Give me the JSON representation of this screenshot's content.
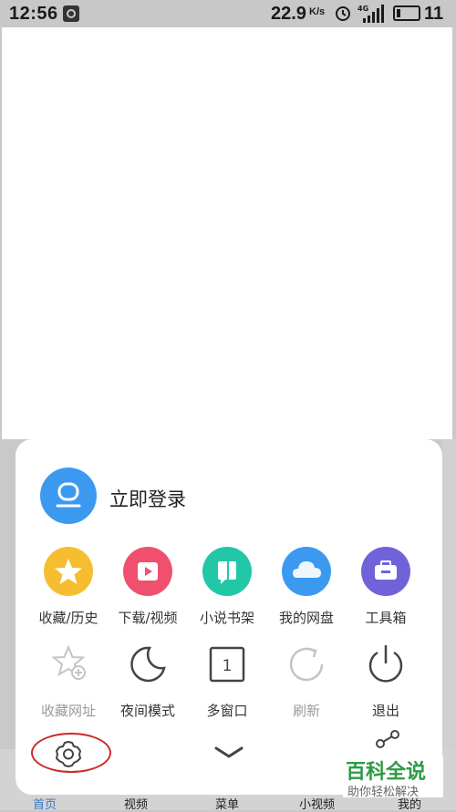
{
  "status_bar": {
    "time": "12:56",
    "speed": "22.9",
    "speed_unit": "K/s",
    "network": "4G",
    "battery": "11"
  },
  "menu": {
    "login_label": "立即登录",
    "row1": [
      {
        "label": "收藏/历史",
        "icon": "star-icon",
        "color": "#f6bd30"
      },
      {
        "label": "下载/视频",
        "icon": "download-video-icon",
        "color": "#f0506e"
      },
      {
        "label": "小说书架",
        "icon": "book-icon",
        "color": "#22c7a8"
      },
      {
        "label": "我的网盘",
        "icon": "cloud-icon",
        "color": "#3b9af0"
      },
      {
        "label": "工具箱",
        "icon": "toolbox-icon",
        "color": "#7063d9"
      }
    ],
    "row2": [
      {
        "label": "收藏网址",
        "icon": "bookmark-add-icon"
      },
      {
        "label": "夜间模式",
        "icon": "moon-icon"
      },
      {
        "label": "多窗口",
        "icon": "window-count-icon",
        "count": "1"
      },
      {
        "label": "刷新",
        "icon": "refresh-icon"
      },
      {
        "label": "退出",
        "icon": "power-icon"
      }
    ]
  },
  "bottom_nav": {
    "items": [
      "首页",
      "视频",
      "菜单",
      "小视频",
      "我的"
    ]
  },
  "watermark": {
    "title": "百科全说",
    "subtitle": "助你轻松解决"
  }
}
